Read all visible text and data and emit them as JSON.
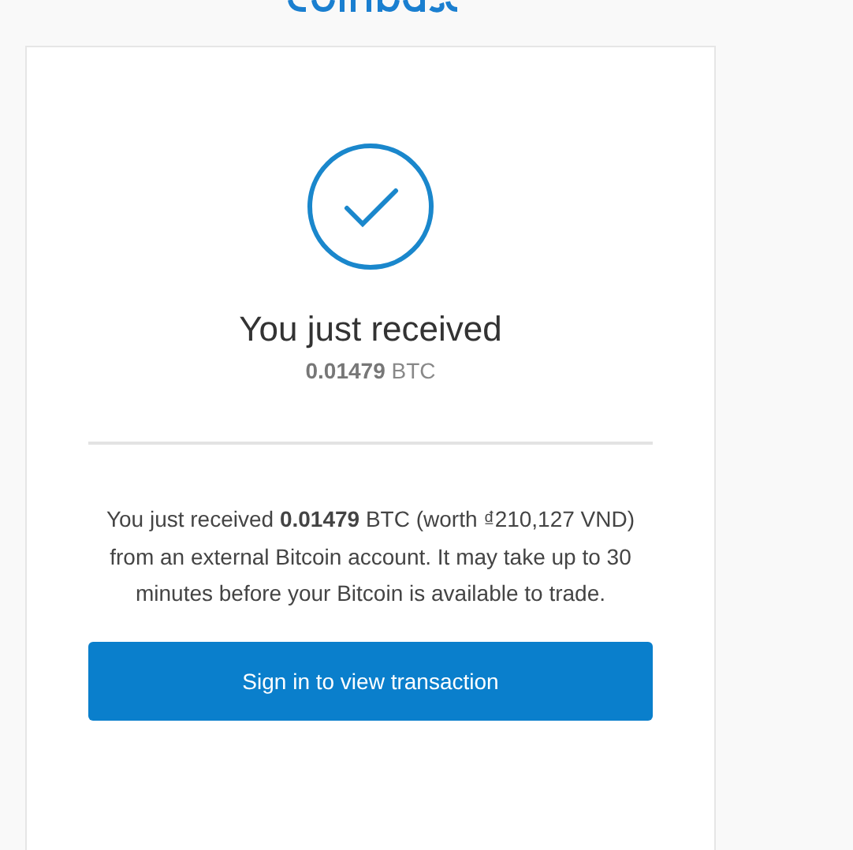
{
  "heading": "You just received",
  "amount": "**0.01479** BTC",
  "message": "You just received **0.01479** BTC (worth ₫210,127 VND) from an external Bitcoin account. It may take up to 30 minutes before your Bitcoin is available to trade.",
  "button": "Sign in to view transaction"
}
